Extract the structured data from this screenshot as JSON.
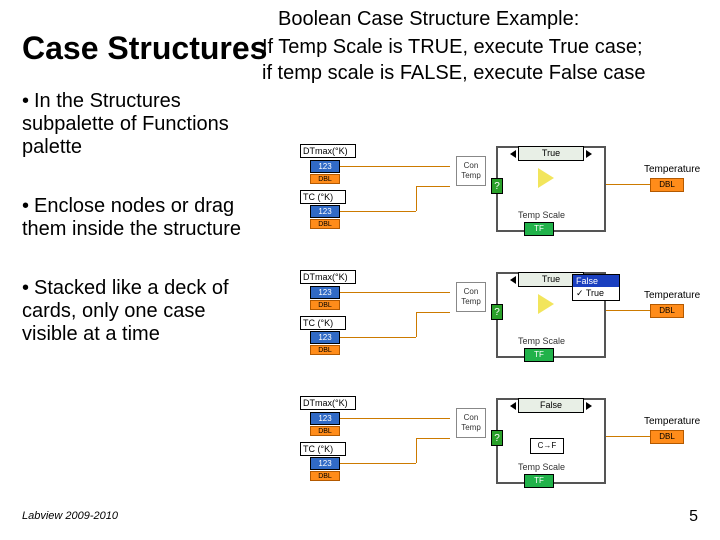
{
  "title": "Case Structures",
  "example": {
    "heading": "Boolean Case Structure Example:",
    "body": "If Temp Scale is TRUE, execute True case;\nif temp scale is FALSE, execute False case"
  },
  "bullets": [
    "In the Structures subpalette of Functions palette",
    "Enclose nodes or drag them inside the structure",
    "Stacked like a deck of cards, only one case visible at a time"
  ],
  "footer": {
    "left": "Labview 2009-2010",
    "page": "5"
  },
  "labels": {
    "dtmax": "DTmax(°K)",
    "tc": "TC (°K)",
    "num": "123",
    "dbl": "DBL",
    "contemp": "Con\nTemp",
    "temperature": "Temperature",
    "tempscale": "Temp Scale",
    "tf": "TF",
    "q": "?",
    "cf": "C→F"
  },
  "diagrams": [
    {
      "selector": "True",
      "popup": null,
      "inner": "triangle"
    },
    {
      "selector": "True",
      "popup": [
        "False",
        "True"
      ],
      "inner": "triangle"
    },
    {
      "selector": "False",
      "popup": null,
      "inner": "cf"
    }
  ],
  "popup_check_index": 1
}
